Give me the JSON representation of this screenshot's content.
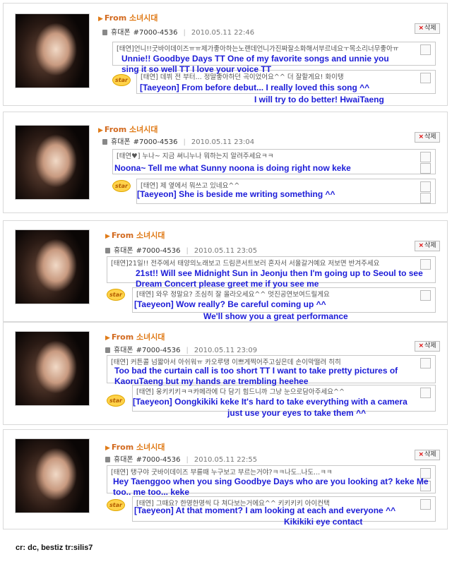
{
  "posts": [
    {
      "from_label": "From",
      "from_source": "소녀시대",
      "phone_label": "휴대폰",
      "number": "#7000-4536",
      "date": "2010.05.11 22:46",
      "delete_label": "삭제",
      "message": "[태연]언니!!굿바이데이즈ㅠㅠ제가좋아하는노랜데언니가진짜잘소화해서부르네요ㅜ목소리너무좋아ㅠ",
      "message_tr": "Unnie!! Goodbye Days TT One of my favorite songs and unnie you sing it so well TT I love your voice TT",
      "star_label": "star",
      "reply": "[태연] 데뷔 전 부터... 정말좋아하던 곡이었어요^^ 더 잘할게요! 화이탱",
      "reply_tr_1": "[Taeyeon] From before debut... I really loved this song ^^",
      "reply_tr_2": "I will try to do better! HwaiTaeng"
    },
    {
      "from_label": "From",
      "from_source": "소녀시대",
      "phone_label": "휴대폰",
      "number": "#7000-4536",
      "date": "2010.05.11 23:04",
      "delete_label": "삭제",
      "message": "[태연♥] 누나~ 지금 써니누나 뭐하는지 알려주세요ㅋㅋ",
      "message_tr": "Noona~ Tell me what Sunny noona is doing right now keke",
      "star_label": "star",
      "reply": "[태연] 제 옆에서 뭐쓰고 있네요^^",
      "reply_tr_1": "[Taeyeon] She is beside me writing something ^^"
    },
    {
      "from_label": "From",
      "from_source": "소녀시대",
      "phone_label": "휴대폰",
      "number": "#7000-4536",
      "date": "2010.05.11 23:05",
      "delete_label": "삭제",
      "message": "[태연]21일!! 전주에서 태양의노래보고 드림콘서트보러 혼자서 서울갈거예요 저보면 반겨주세요",
      "message_tr": "21st!! Will see Midnight Sun in Jeonju then I'm going up to Seoul to see Dream Concert please greet me if you see me",
      "star_label": "star",
      "reply": "[태연] 와우 정말요? 조심히 잘 올라오세요^^ 멋진공연보여드릴게요",
      "reply_tr_1": "[Taeyeon] Wow really? Be careful coming up ^^",
      "reply_tr_2": "We'll show you a great performance"
    },
    {
      "from_label": "From",
      "from_source": "소녀시대",
      "phone_label": "휴대폰",
      "number": "#7000-4536",
      "date": "2010.05.11 23:09",
      "delete_label": "삭제",
      "message": "[태연] 커튼콜 넘짧아서 아쉬워ㅠ 카오루탱 이쁘게찍어주고싶은데 손이막떨려 히히",
      "message_tr": "Too bad the curtain call is too short TT I want to take pretty pictures of KaoruTaeng but my hands are trembling heehee",
      "star_label": "star",
      "reply": "[태연] 웅키키키ㅋㅋ카메라에 다 담기 힘드니까 그냥 눈으로담아주세요^^",
      "reply_tr_1": "[Taeyeon] Oongkikiki keke It's hard to take everything with a camera",
      "reply_tr_2": "just use your eyes to take them ^^"
    },
    {
      "from_label": "From",
      "from_source": "소녀시대",
      "phone_label": "휴대폰",
      "number": "#7000-4536",
      "date": "2010.05.11 22:55",
      "delete_label": "삭제",
      "message": "[태연] 탱구야 굿바이데이즈 부를때 누구보고 부르는거야?ㅋㅋ나도..나도...ㅋㅋ",
      "message_tr": "Hey Taenggoo when you sing Goodbye Days who are you looking at? keke Me too.. me too... keke",
      "star_label": "star",
      "reply": "[태연] 그때요? 한명한명씩 다 쳐다보는거에요^^ 키키키키 아이컨택",
      "reply_tr_1": "[Taeyeon] At that moment? I am looking at each and everyone ^^",
      "reply_tr_2": "Kikikiki eye contact"
    }
  ],
  "credit": "cr: dc, bestiz  tr:silis7"
}
